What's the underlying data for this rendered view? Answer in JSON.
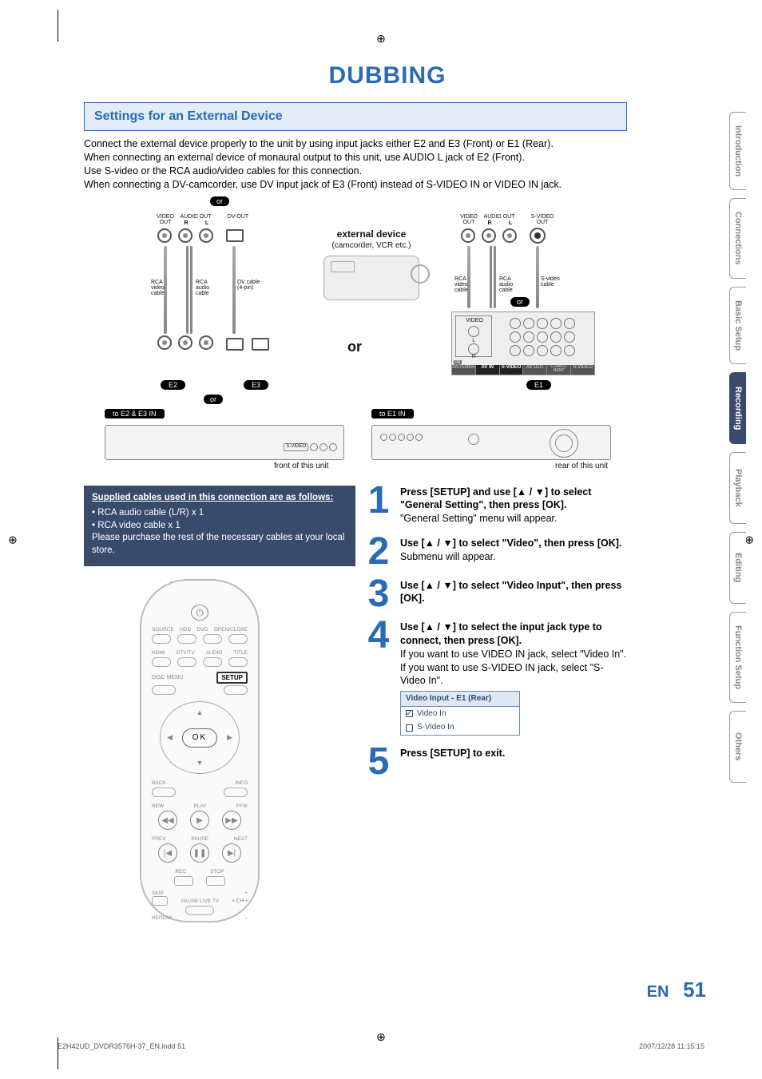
{
  "title": "DUBBING",
  "section_header": "Settings for an External Device",
  "intro_lines": [
    "Connect the external device properly to the unit by using input jacks either E2 and E3 (Front) or E1 (Rear).",
    "When connecting an external device of monaural output to this unit, use AUDIO L jack of E2 (Front).",
    "Use S-video or the RCA audio/video cables for this connection.",
    "When connecting a DV-camcorder, use DV input jack of E3 (Front) instead of S-VIDEO IN or VIDEO IN jack."
  ],
  "diagram": {
    "or": "or",
    "video_out": "VIDEO\nOUT",
    "audio_out_r": "AUDIO OUT",
    "audio_r": "R",
    "audio_l": "L",
    "dv_out": "DV-OUT",
    "svideo_out": "S-VIDEO\nOUT",
    "rca_video_cable": "RCA\nvideo\ncable",
    "rca_audio_cable": "RCA\naudio\ncable",
    "dv_cable": "DV cable\n(4-pin)",
    "svideo_cable": "S-video\ncable",
    "external_device": "external device",
    "external_sub": "(camcorder, VCR etc.)",
    "big_or": "or",
    "e2": "E2",
    "e3": "E3",
    "e1": "E1",
    "to_e2e3": "to E2 & E3 IN",
    "to_e1": "to E1 IN",
    "front_caption": "front of this unit",
    "rear_caption": "rear of this unit",
    "rear_labels": {
      "antenna": "ANTENNA",
      "av_in": "AV IN",
      "svideo": "S-VIDEO",
      "av_out": "AV OUT",
      "comp": "COMPO-\nNENT",
      "in": "IN",
      "out": "OUT",
      "video": "VIDEO",
      "l": "L",
      "r": "R"
    }
  },
  "cables_box": {
    "heading": "Supplied cables used in this connection are as follows:",
    "line1": "• RCA audio cable (L/R) x 1",
    "line2": "• RCA video cable x 1",
    "line3": "Please purchase the rest of the necessary cables at your local store."
  },
  "remote": {
    "row1": [
      "SOURCE",
      "HDD",
      "DVD",
      "OPEN/CLOSE"
    ],
    "row2": [
      "HDMI",
      "DTV/TV",
      "AUDIO",
      "TITLE"
    ],
    "disc_menu": "DISC MENU",
    "setup": "SETUP",
    "ok": "OK",
    "back": "BACK",
    "info": "INFO",
    "rew": "REW",
    "play": "PLAY",
    "ffw": "FFW",
    "prev": "PREV",
    "pause": "PAUSE",
    "next": "NEXT",
    "rec": "REC",
    "stop": "STOP",
    "skip": "SKIP",
    "pause_live": "PAUSE LIVE TV",
    "ch": "• CH •",
    "replay": "REPLAY"
  },
  "steps": {
    "s1": {
      "num": "1",
      "bold": "Press [SETUP] and use [▲ / ▼] to select \"General Setting\", then press [OK].",
      "rest": "\"General Setting\" menu will appear."
    },
    "s2": {
      "num": "2",
      "bold": "Use [▲ / ▼] to select \"Video\", then press [OK].",
      "rest": "Submenu will appear."
    },
    "s3": {
      "num": "3",
      "bold": "Use [▲ / ▼] to select \"Video Input\", then press [OK].",
      "rest": ""
    },
    "s4": {
      "num": "4",
      "bold": "Use [▲ / ▼] to select the input jack type to connect, then press [OK].",
      "rest1": "If you want to use VIDEO IN jack, select \"Video In\".",
      "rest2": " If you want to use S-VIDEO IN jack, select \"S-Video In\"."
    },
    "s5": {
      "num": "5",
      "bold": "Press [SETUP] to exit.",
      "rest": ""
    }
  },
  "menu": {
    "header": "Video Input - E1 (Rear)",
    "opt1": "Video In",
    "opt2": "S-Video In"
  },
  "tabs": [
    "Introduction",
    "Connections",
    "Basic Setup",
    "Recording",
    "Playback",
    "Editing",
    "Function Setup",
    "Others"
  ],
  "active_tab_index": 3,
  "footer": {
    "lang": "EN",
    "page": "51"
  },
  "footnote": {
    "left": "E2H42UD_DVDR3576H-37_EN.indd   51",
    "right": "2007/12/28   11:15:15"
  }
}
